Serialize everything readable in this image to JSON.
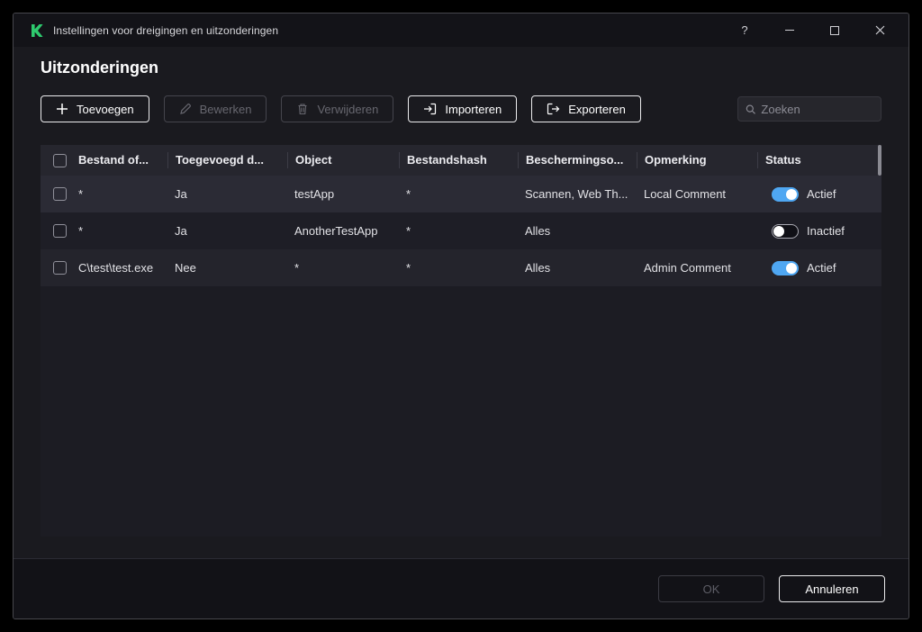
{
  "window": {
    "title": "Instellingen voor dreigingen en uitzonderingen",
    "help_label": "?",
    "page_title": "Uitzonderingen"
  },
  "toolbar": {
    "add_label": "Toevoegen",
    "edit_label": "Bewerken",
    "delete_label": "Verwijderen",
    "import_label": "Importeren",
    "export_label": "Exporteren",
    "search_placeholder": "Zoeken"
  },
  "table": {
    "headers": [
      "Bestand of...",
      "Toegevoegd d...",
      "Object",
      "Bestandshash",
      "Beschermingso...",
      "Opmerking",
      "Status"
    ],
    "rows": [
      {
        "file": "*",
        "added": "Ja",
        "object": "testApp",
        "hash": "*",
        "protection": "Scannen, Web Th...",
        "comment": "Local Comment",
        "status": "Actief",
        "active": true
      },
      {
        "file": "*",
        "added": "Ja",
        "object": "AnotherTestApp",
        "hash": "*",
        "protection": "Alles",
        "comment": "",
        "status": "Inactief",
        "active": false
      },
      {
        "file": "C\\test\\test.exe",
        "added": "Nee",
        "object": "*",
        "hash": "*",
        "protection": "Alles",
        "comment": "Admin Comment",
        "status": "Actief",
        "active": true
      }
    ]
  },
  "footer": {
    "ok_label": "OK",
    "cancel_label": "Annuleren"
  },
  "colors": {
    "brand_green": "#2ecb6e",
    "toggle_active": "#4fa7f2"
  }
}
